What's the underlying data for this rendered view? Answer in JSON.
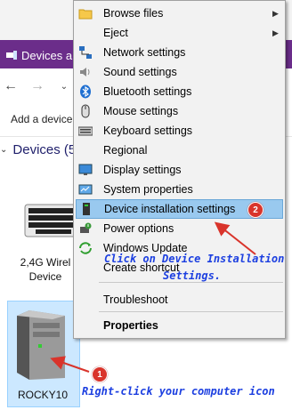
{
  "window": {
    "tab_title": "Devices an",
    "add_device_label": "Add a device",
    "section_title": "Devices (5",
    "devices": [
      {
        "label_line1": "2,4G Wirel",
        "label_line2": "Device"
      },
      {
        "label": "ROCKY10"
      }
    ]
  },
  "menu": {
    "items": [
      {
        "label": "Browse files",
        "icon": "folder-icon",
        "submenu": true
      },
      {
        "label": "Eject",
        "icon": "eject-icon",
        "submenu": true
      },
      {
        "label": "Network settings",
        "icon": "network-icon"
      },
      {
        "label": "Sound settings",
        "icon": "speaker-icon"
      },
      {
        "label": "Bluetooth settings",
        "icon": "bluetooth-icon"
      },
      {
        "label": "Mouse settings",
        "icon": "mouse-icon"
      },
      {
        "label": "Keyboard settings",
        "icon": "keyboard-icon"
      },
      {
        "label": "Regional",
        "icon": ""
      },
      {
        "label": "Display settings",
        "icon": "monitor-icon"
      },
      {
        "label": "System properties",
        "icon": "system-icon"
      },
      {
        "label": "Device installation settings",
        "icon": "device-install-icon",
        "highlighted": true
      },
      {
        "label": "Power options",
        "icon": "power-icon"
      },
      {
        "label": "Windows Update",
        "icon": "windows-update-icon"
      },
      {
        "label": "Create shortcut",
        "icon": ""
      },
      {
        "label": "Troubleshoot",
        "icon": ""
      },
      {
        "label": "Properties",
        "icon": "",
        "bold": true
      }
    ]
  },
  "annotations": {
    "step1_badge": "1",
    "step2_badge": "2",
    "step1_text": "Right-click your computer icon",
    "step2_text_line1": "Click on Device Installation",
    "step2_text_line2": "Settings.",
    "color": "#1c3fe0",
    "badge_color": "#d9342b"
  }
}
